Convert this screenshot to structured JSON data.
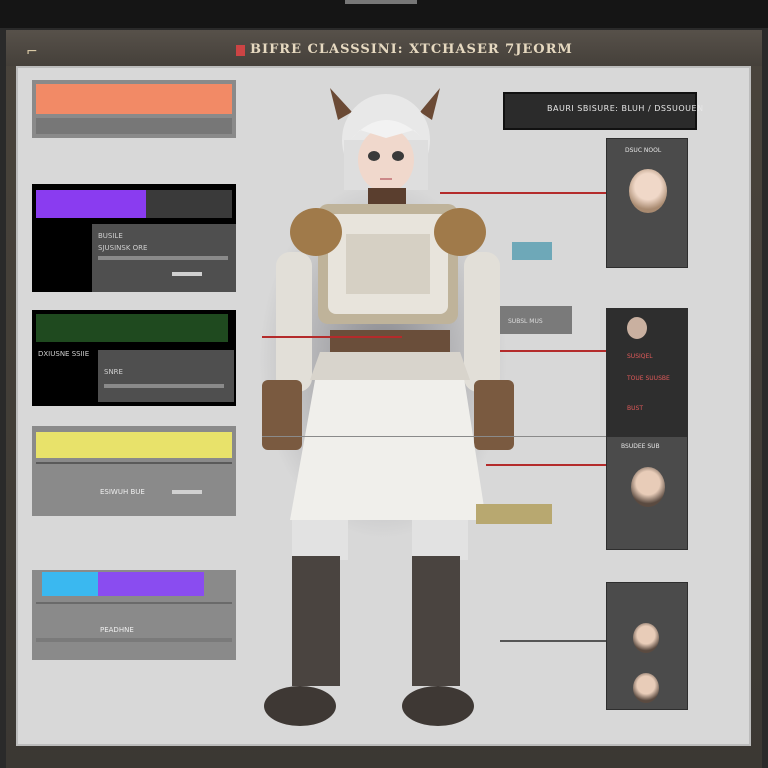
{
  "title": {
    "mark": "⌐",
    "text": "BIFRE CLASSSINI: XTCHASER 7JEORM"
  },
  "cards": [
    {
      "accent": "#f28a66",
      "label": "",
      "value": ""
    },
    {
      "accent": "#8a3cf0",
      "label": "BUSILE",
      "value": "SJUSINSK ORE"
    },
    {
      "accent": "#1f4a1f",
      "label": "DXIUSNE SSIIE",
      "value": "SNRE"
    },
    {
      "accent": "#e8e26a",
      "label": "",
      "value": "ESIWUH BUE"
    },
    {
      "accent_a": "#3ab8f0",
      "accent_b": "#8a4cf0",
      "label": "PEADHNE",
      "value": ""
    }
  ],
  "right_panel": {
    "header": "BAURI SBISURE: BLUH / DSSUOUEN",
    "card1_caption": "DSUC NOOL",
    "card2_lines": [
      "SUSIQEL",
      "TOUE SUUSBE",
      "BUST"
    ],
    "card3_caption": "BSUDEE SUB",
    "mid_label": "SUBSL MUS",
    "swatch_colors": [
      "#6ea8b8",
      "#b8a870"
    ]
  },
  "colors": {
    "lead_line": "#b42b2b",
    "panel_bg": "#d8d8d8",
    "card_dark": "#4b4b4b"
  }
}
